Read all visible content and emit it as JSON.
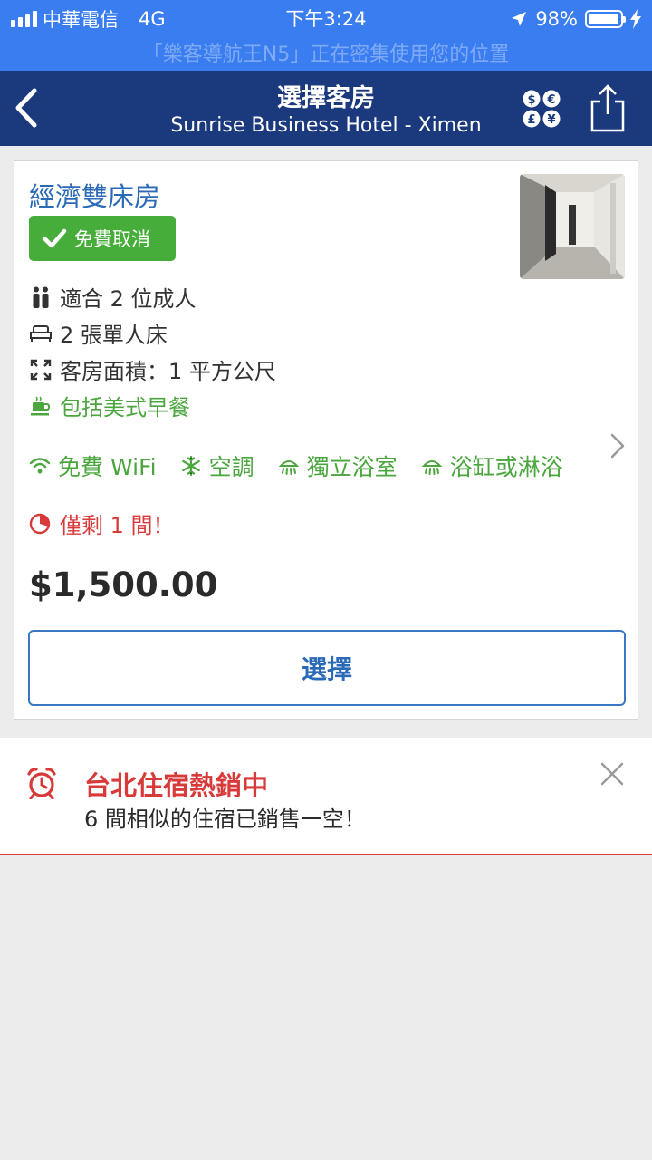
{
  "status_bar": {
    "carrier": "中華電信",
    "network": "4G",
    "time": "下午3:24",
    "battery": "98%",
    "battery_level": 0.98,
    "banner": "「樂客導航王N5」正在密集使用您的位置"
  },
  "header": {
    "title": "選擇客房",
    "subtitle": "Sunrise Business Hotel - Ximen",
    "back_icon": "chevron-left-icon",
    "currency_icon": "currency-icon",
    "share_icon": "share-icon"
  },
  "room": {
    "name": "經濟雙床房",
    "badge": "免費取消",
    "features": [
      {
        "icon": "people-icon",
        "text": "適合 2 位成人"
      },
      {
        "icon": "bed-icon",
        "text": "2 張單人床"
      },
      {
        "icon": "expand-icon",
        "text": "客房面積：1 平方公尺"
      },
      {
        "icon": "coffee-icon",
        "text": "包括美式早餐"
      }
    ],
    "amenities": [
      {
        "icon": "wifi-icon",
        "text": "免費 WiFi"
      },
      {
        "icon": "snowflake-icon",
        "text": "空調"
      },
      {
        "icon": "shower-icon",
        "text": "獨立浴室"
      },
      {
        "icon": "shower-icon",
        "text": "浴缸或淋浴"
      }
    ],
    "scarcity": "僅剩 1 間！",
    "price": "$1,500.00",
    "select_label": "選擇"
  },
  "promo": {
    "title": "台北住宿熱銷中",
    "subtitle": "6 間相似的住宿已銷售一空！"
  },
  "colors": {
    "status_blue": "#3a7df0",
    "header_navy": "#1b3a7d",
    "link_blue": "#2b6ab7",
    "green": "#47ad3a",
    "red": "#d83a3a"
  }
}
